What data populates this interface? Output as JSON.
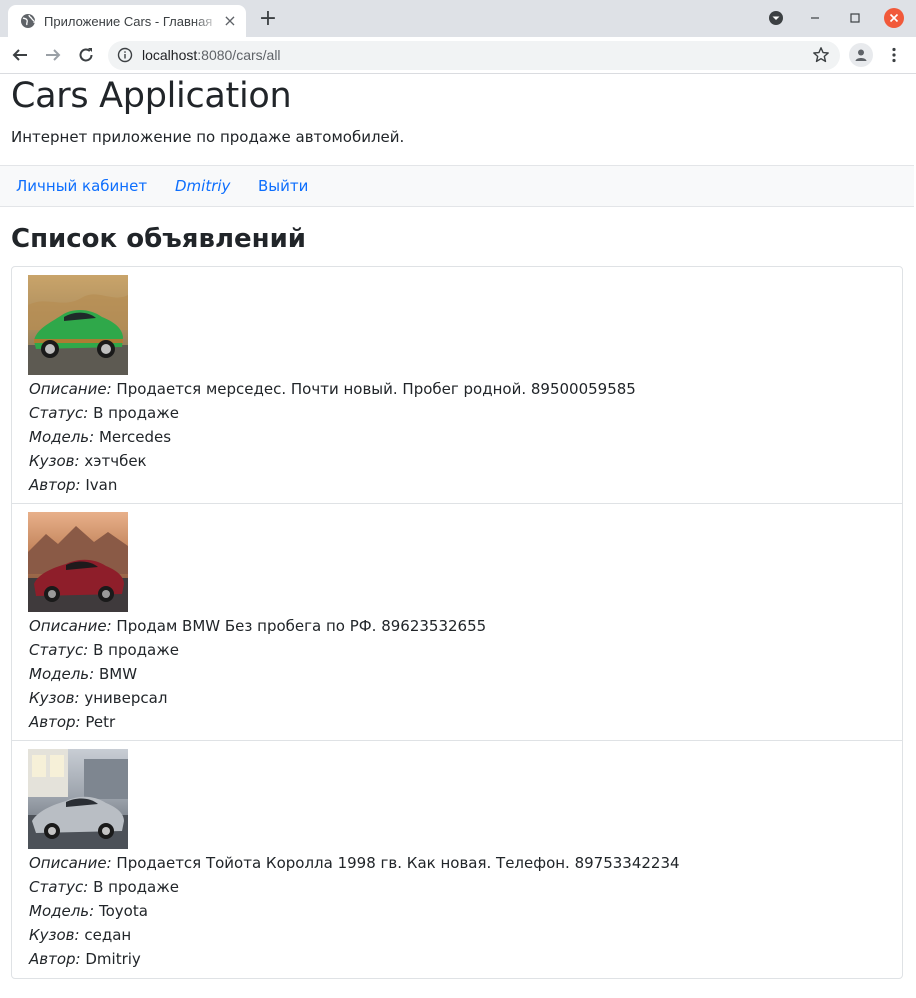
{
  "browser": {
    "tab_title": "Приложение Cars - Главная",
    "url_host": "localhost",
    "url_rest": ":8080/cars/all"
  },
  "site": {
    "title": "Cars Application",
    "subtitle": "Интернет приложение по продаже автомобилей."
  },
  "nav": {
    "cabinet": "Личный кабинет",
    "user": "Dmitriy",
    "logout": "Выйти"
  },
  "list_title": "Список объявлений",
  "labels": {
    "description": "Описание:",
    "status": "Статус:",
    "model": "Модель:",
    "body": "Кузов:",
    "author": "Автор:"
  },
  "ads": [
    {
      "description": "Продается мерседес. Почти новый. Пробег родной. 89500059585",
      "status": "В продаже",
      "model": "Mercedes",
      "body": "хэтчбек",
      "author": "Ivan",
      "image_icon": "green-sports-car-photo"
    },
    {
      "description": "Продам BMW Без пробега по РФ. 89623532655",
      "status": "В продаже",
      "model": "BMW",
      "body": "универсал",
      "author": "Petr",
      "image_icon": "red-coupe-photo"
    },
    {
      "description": "Продается Тойота Королла 1998 гв. Как новая. Телефон. 89753342234",
      "status": "В продаже",
      "model": "Toyota",
      "body": "седан",
      "author": "Dmitriy",
      "image_icon": "silver-coupe-photo"
    }
  ],
  "colors": {
    "link": "#0d6efd",
    "navbar_bg": "#f8f9fa",
    "border": "#dfe2e5",
    "close_button": "#f1593a"
  }
}
